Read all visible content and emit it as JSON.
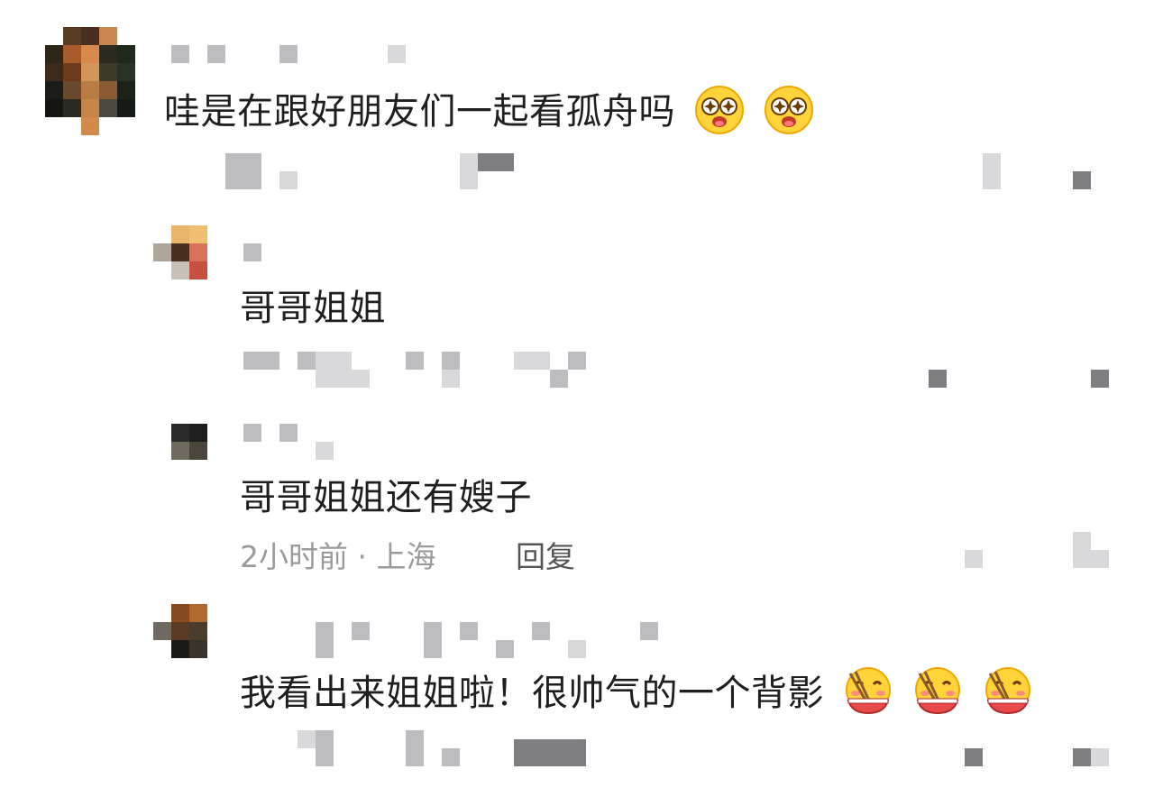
{
  "comments": [
    {
      "text": "哇是在跟好朋友们一起看孤舟吗",
      "emojis": [
        "star-eyes-emoji",
        "star-eyes-emoji"
      ]
    },
    {
      "text": "哥哥姐姐",
      "emojis": []
    },
    {
      "text": "哥哥姐姐还有嫂子",
      "meta": "2小时前 · 上海",
      "reply_label": "回复",
      "emojis": []
    },
    {
      "text": "我看出来姐姐啦！很帅气的一个背影",
      "emojis": [
        "hungry-eating-emoji",
        "hungry-eating-emoji",
        "hungry-eating-emoji"
      ]
    }
  ],
  "colors": {
    "text": "#1f1f1f",
    "meta": "#9b9b9b",
    "reply": "#555555",
    "emoji_face": "#ffd43b",
    "emoji_blush": "#ff8a80"
  }
}
